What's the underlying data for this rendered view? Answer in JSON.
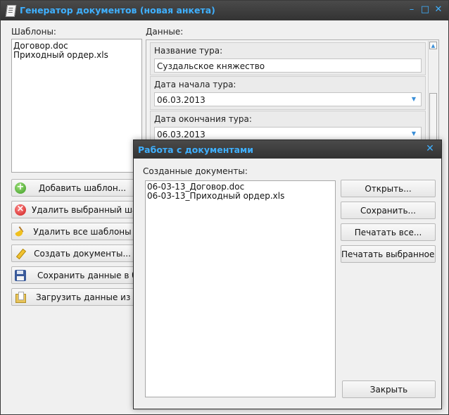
{
  "window": {
    "title": "Генератор документов (новая анкета)",
    "controls": {
      "minimize": "–",
      "maximize": "□",
      "close": "✕"
    }
  },
  "templates": {
    "label": "Шаблоны:",
    "items": [
      "Договор.doc",
      "Приходный ордер.xls"
    ]
  },
  "actions": {
    "add_template": "Добавить шаблон...",
    "delete_selected": "Удалить выбранный шаблон",
    "delete_all": "Удалить все шаблоны",
    "create_docs": "Создать документы...",
    "save_db": "Сохранить данные в базе",
    "load_db": "Загрузить данные из базы"
  },
  "data": {
    "label": "Данные:",
    "tour_name_label": "Название тура:",
    "tour_name_value": "Суздальское княжество",
    "start_date_label": "Дата начала тура:",
    "start_date_value": "06.03.2013",
    "end_date_label": "Дата окончания тура:",
    "end_date_value": "06.03.2013"
  },
  "dialog": {
    "title": "Работа с документами",
    "close": "✕",
    "created_label": "Созданные документы:",
    "documents": [
      "06-03-13_Договор.doc",
      "06-03-13_Приходный ордер.xls"
    ],
    "open": "Открыть...",
    "save": "Сохранить...",
    "print_all": "Печатать все...",
    "print_selected": "Печатать выбранное...",
    "close_button": "Закрыть"
  },
  "colors": {
    "title_accent": "#3fb0ff",
    "titlebar_bg": "#3a3a3a",
    "panel_bg": "#f0f0f0"
  }
}
